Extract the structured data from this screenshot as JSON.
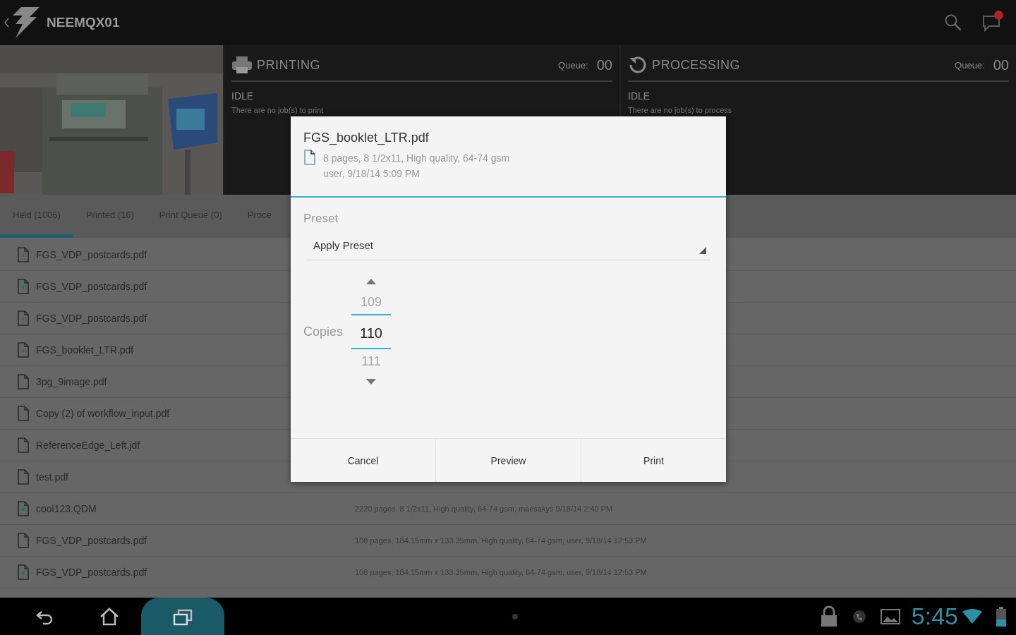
{
  "app_bar": {
    "title": "NEEMQX01",
    "notification": true
  },
  "header": {
    "status_panels": [
      {
        "kind": "printing",
        "title": "PRINTING",
        "queue_label": "Queue:",
        "queue": "00",
        "state": "IDLE",
        "message": "There are no job(s) to print"
      },
      {
        "kind": "processing",
        "title": "PROCESSING",
        "queue_label": "Queue:",
        "queue": "00",
        "state": "IDLE",
        "message": "There are no job(s) to process"
      }
    ]
  },
  "tabs": [
    {
      "label": "Held (1006)",
      "selected": true
    },
    {
      "label": "Printed (16)",
      "selected": false
    },
    {
      "label": "Print Queue (0)",
      "selected": false
    },
    {
      "label": "Proce",
      "selected": false
    }
  ],
  "jobs": [
    {
      "name": "FGS_VDP_postcards.pdf",
      "marked": true
    },
    {
      "name": "FGS_VDP_postcards.pdf",
      "marked": true
    },
    {
      "name": "FGS_VDP_postcards.pdf",
      "marked": true
    },
    {
      "name": "FGS_booklet_LTR.pdf",
      "marked": true
    },
    {
      "name": "3pg_9image.pdf",
      "marked": false
    },
    {
      "name": "Copy (2) of workflow_input.pdf",
      "marked": false
    },
    {
      "name": "ReferenceEdge_Left.jdf",
      "marked": false
    },
    {
      "name": "test.pdf",
      "marked": false
    },
    {
      "name": "cool123.QDM",
      "marked": true,
      "details": "2220 pages, 8 1/2x11, High quality, 64-74 gsm, maesakys 9/18/14 2:40 PM"
    },
    {
      "name": "FGS_VDP_postcards.pdf",
      "marked": false,
      "details": "108 pages, 184.15mm x 133.35mm, High quality, 64-74 gsm, user, 9/18/14 12:53 PM"
    },
    {
      "name": "FGS_VDP_postcards.pdf",
      "marked": true,
      "details": "108 pages, 184.15mm x 133.35mm, High quality, 64-74 gsm, user, 9/18/14 12:53 PM"
    }
  ],
  "dialog": {
    "file_name": "FGS_booklet_LTR.pdf",
    "info_lines": [
      "8 pages, 8 1/2x11, High quality, 64-74 gsm",
      "user, 9/18/14 5:09 PM"
    ],
    "preset_label": "Preset",
    "preset_value": "Apply Preset",
    "copies_label": "Copies",
    "copies_prev": "109",
    "copies": "110",
    "copies_next": "111",
    "buttons": [
      "Cancel",
      "Preview",
      "Print"
    ]
  },
  "nav_bar": {
    "items": [
      {
        "kind": "back",
        "selected": false
      },
      {
        "kind": "home",
        "selected": false
      },
      {
        "kind": "recent",
        "selected": true
      }
    ],
    "time": "5:45"
  }
}
